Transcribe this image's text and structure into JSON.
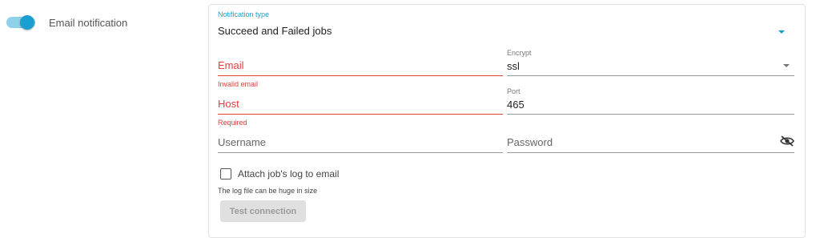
{
  "toggle": {
    "label": "Email notification",
    "on": true
  },
  "notification_type": {
    "label": "Notification type",
    "value": "Succeed and Failed jobs"
  },
  "email": {
    "placeholder": "Email",
    "error": "Invalid email"
  },
  "encrypt": {
    "label": "Encrypt",
    "value": "ssl"
  },
  "host": {
    "placeholder": "Host",
    "error": "Required"
  },
  "port": {
    "label": "Port",
    "value": "465"
  },
  "username": {
    "placeholder": "Username"
  },
  "password": {
    "placeholder": "Password"
  },
  "attach_log": {
    "label": "Attach job's log to email",
    "hint": "The log file can be huge in size",
    "checked": false
  },
  "test_button": {
    "label": "Test connection"
  },
  "colors": {
    "accent": "#1a9fd0",
    "error": "#e04040"
  }
}
